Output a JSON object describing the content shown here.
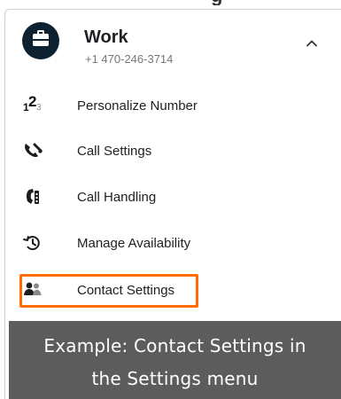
{
  "top_fragment": {
    "left_text": "",
    "right_text": "g"
  },
  "account": {
    "name": "Work",
    "phone": "+1 470-246-3714",
    "avatar_icon": "briefcase-icon",
    "collapse_icon": "chevron-up-icon"
  },
  "menu": {
    "items": [
      {
        "label": "Personalize Number",
        "icon": "number-123-icon",
        "number_icon": {
          "first": "1",
          "second": "2",
          "third": "3"
        }
      },
      {
        "label": "Call Settings",
        "icon": "phone-wrench-icon"
      },
      {
        "label": "Call Handling",
        "icon": "phone-handling-icon"
      },
      {
        "label": "Manage Availability",
        "icon": "history-icon"
      },
      {
        "label": "Contact Settings",
        "icon": "contacts-icon"
      }
    ]
  },
  "highlight": {
    "target": "Contact Settings",
    "color": "#ff6d00"
  },
  "caption": {
    "line1": "Example: Contact Settings in",
    "line2": "the Settings menu"
  },
  "colors": {
    "avatar": "#0d2131",
    "overlay": "#525252",
    "highlight": "#ff6d00"
  }
}
